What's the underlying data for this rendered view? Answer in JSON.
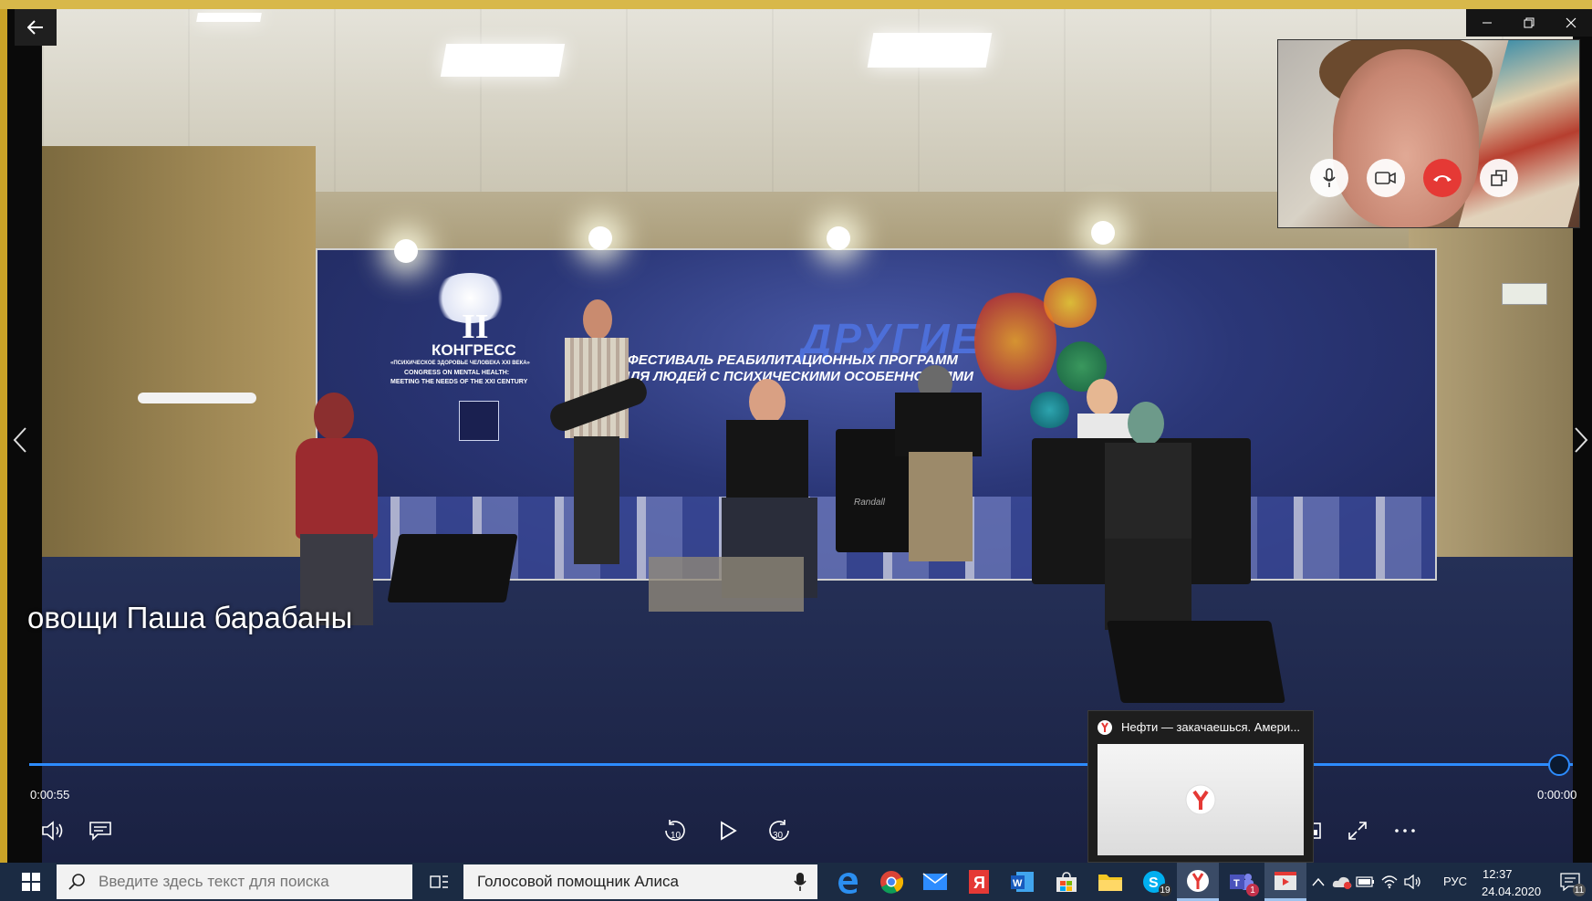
{
  "player": {
    "subtitle": "овощи Паша барабаны",
    "time_elapsed": "0:00:55",
    "time_remaining": "0:00:00",
    "progress": 1.0,
    "accent_color": "#2d8cff"
  },
  "stage_banner": {
    "congress_numeral": "II",
    "congress_title": "КОНГРЕСС",
    "congress_sub1": "«ПСИХИЧЕСКОЕ ЗДОРОВЬЕ ЧЕЛОВЕКА XXI ВЕКА»",
    "congress_sub2": "CONGRESS ON MENTAL HEALTH:",
    "congress_sub3": "MEETING THE NEEDS OF THE XXI CENTURY",
    "festival_name": "ДРУГИЕ",
    "festival_line1": "ФЕСТИВАЛЬ РЕАБИЛИТАЦИОННЫХ ПРОГРАММ",
    "festival_line2": "ДЛЯ ЛЮДЕЙ С ПСИХИЧЕСКИМИ ОСОБЕННОСТЯМИ",
    "amp_brand": "Randall"
  },
  "popup": {
    "title": "Нефти — закачаешься. Амери..."
  },
  "taskbar": {
    "search_placeholder": "Введите здесь текст для поиска",
    "alice_label": "Голосовой помощник Алиса",
    "skype_badge": "19",
    "teams_badge": "1",
    "language": "РУС",
    "time": "12:37",
    "date": "24.04.2020",
    "notification_count": "11"
  }
}
